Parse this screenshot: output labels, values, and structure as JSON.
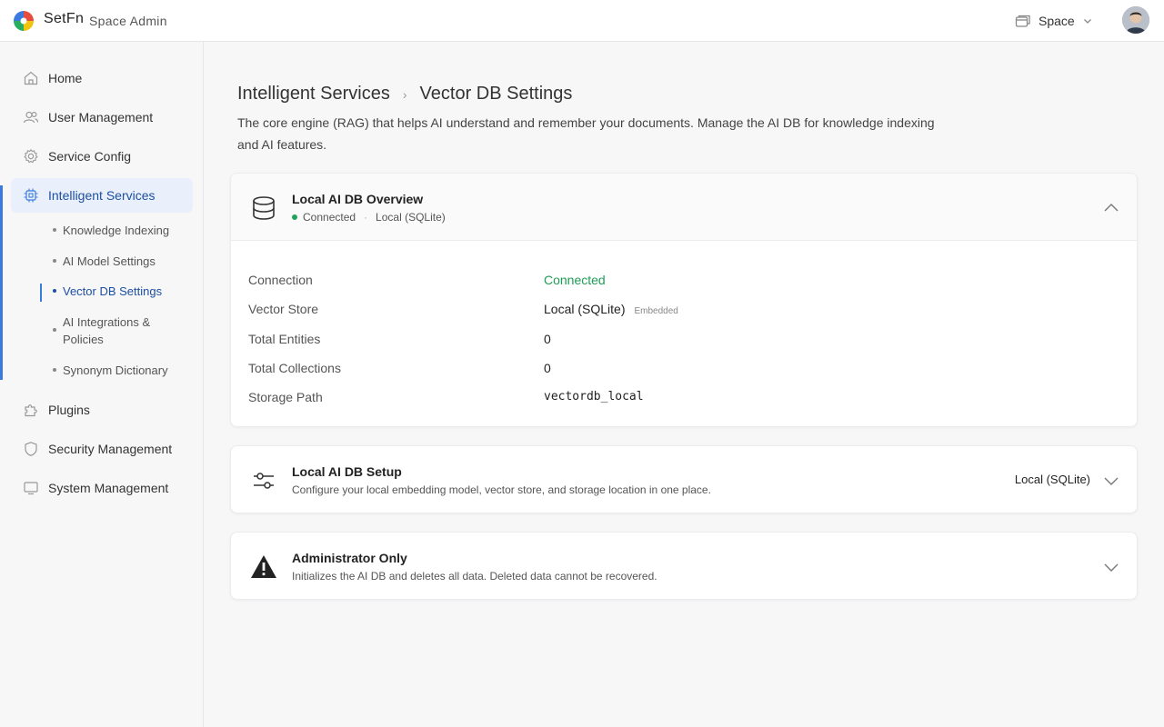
{
  "header": {
    "brand": "SetFn",
    "brand_sub": "Space Admin",
    "space_label": "Space"
  },
  "sidebar": {
    "items": [
      {
        "label": "Home",
        "icon": "home-icon"
      },
      {
        "label": "User Management",
        "icon": "users-icon"
      },
      {
        "label": "Service Config",
        "icon": "gear-icon"
      },
      {
        "label": "Intelligent Services",
        "icon": "chip-icon"
      },
      {
        "label": "Plugins",
        "icon": "puzzle-icon"
      },
      {
        "label": "Security Management",
        "icon": "shield-icon"
      },
      {
        "label": "System Management",
        "icon": "monitor-icon"
      }
    ],
    "sub_items": [
      {
        "label": "Knowledge Indexing"
      },
      {
        "label": "AI Model Settings"
      },
      {
        "label": "Vector DB Settings"
      },
      {
        "label": "AI Integrations & Policies"
      },
      {
        "label": "Synonym Dictionary"
      }
    ]
  },
  "breadcrumb": {
    "parent": "Intelligent Services",
    "separator": "›",
    "current": "Vector DB Settings"
  },
  "description": "The core engine (RAG) that helps AI understand and remember your documents. Manage the AI DB for knowledge indexing and AI features.",
  "overview": {
    "title": "Local AI DB Overview",
    "status": "Connected",
    "dot_sep": "·",
    "store": "Local (SQLite)",
    "rows": {
      "connection_label": "Connection",
      "connection_value": "Connected",
      "store_label": "Vector Store",
      "store_value": "Local (SQLite)",
      "store_tag": "Embedded",
      "entities_label": "Total Entities",
      "entities_value": "0",
      "collections_label": "Total Collections",
      "collections_value": "0",
      "path_label": "Storage Path",
      "path_value": "vectordb_local"
    }
  },
  "setup": {
    "title": "Local AI DB Setup",
    "subtitle": "Configure your local embedding model, vector store, and storage location in one place.",
    "value": "Local (SQLite)"
  },
  "admin": {
    "title": "Administrator Only",
    "subtitle": "Initializes the AI DB and deletes all data. Deleted data cannot be recovered."
  },
  "colors": {
    "accent": "#3b7be0",
    "active_text": "#1d4fa3",
    "success": "#1f9d55"
  }
}
